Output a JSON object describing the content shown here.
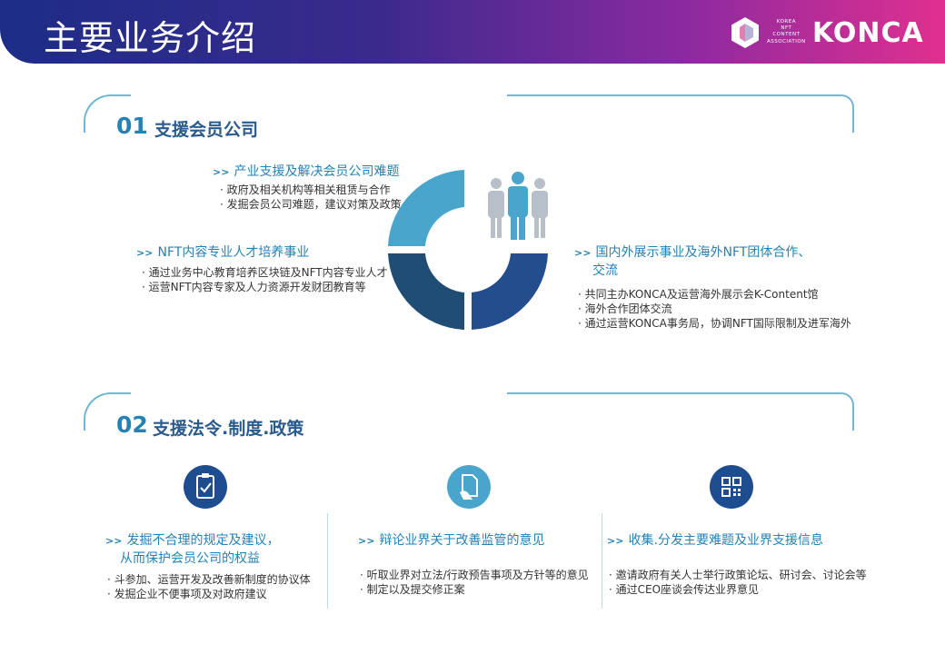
{
  "header": {
    "title": "主要业务介绍"
  },
  "logo": {
    "small_lines": [
      "KOREA",
      "NFT",
      "CONTENT",
      "ASSOCIATION"
    ],
    "word": "KONCA",
    "icon": "konca-logo-icon"
  },
  "section1": {
    "number": "01",
    "title": "支援会员公司",
    "blocks": [
      {
        "arrow": ">>",
        "heading": "产业支援及解决会员公司难题",
        "bullets": [
          "政府及相关机构等相关租赁与合作",
          "发掘会员公司难题，建议对策及政策"
        ]
      },
      {
        "arrow": ">>",
        "heading": "NFT内容专业人才培养事业",
        "bullets": [
          "通过业务中心教育培养区块链及NFT内容专业人才",
          "运营NFT内容专家及人力资源开发财团教育等"
        ]
      },
      {
        "arrow": ">>",
        "heading_lines": [
          "国内外展示事业及海外NFT团体合作、",
          "交流"
        ],
        "bullets": [
          "共同主办KONCA及运营海外展示会K-Content馆",
          "海外合作团体交流",
          "通过运营KONCA事务局，协调NFT国际限制及进军海外"
        ]
      }
    ],
    "donut_colors": [
      "#4aa5cc",
      "#244d8d",
      "#1f4d74",
      "#ffffff"
    ],
    "people_icon": "people-group-icon"
  },
  "section2": {
    "number": "02",
    "title": "支援法令.制度.政策",
    "columns": [
      {
        "icon": "clipboard-check-icon",
        "icon_bg": "#1e4d8f",
        "arrow": ">>",
        "heading_lines": [
          "发掘不合理的规定及建议，",
          "从而保护会员公司的权益"
        ],
        "bullets": [
          "斗参加、运营开发及改善新制度的协议体",
          "发掘企业不便事项及对政府建议"
        ]
      },
      {
        "icon": "document-hand-icon",
        "icon_bg": "#4aa5cc",
        "arrow": ">>",
        "heading_lines": [
          "辩论业界关于改善监管的意见"
        ],
        "bullets": [
          "听取业界对立法/行政预告事项及方针等的意见",
          "制定以及提交修正案"
        ]
      },
      {
        "icon": "qr-grid-icon",
        "icon_bg": "#1e4d8f",
        "arrow": ">>",
        "heading_lines": [
          "收集.分发主要难题及业界支援信息"
        ],
        "bullets": [
          "邀请政府有关人士举行政策论坛、研讨会、讨论会等",
          "通过CEO座谈会传达业界意见"
        ]
      }
    ]
  }
}
